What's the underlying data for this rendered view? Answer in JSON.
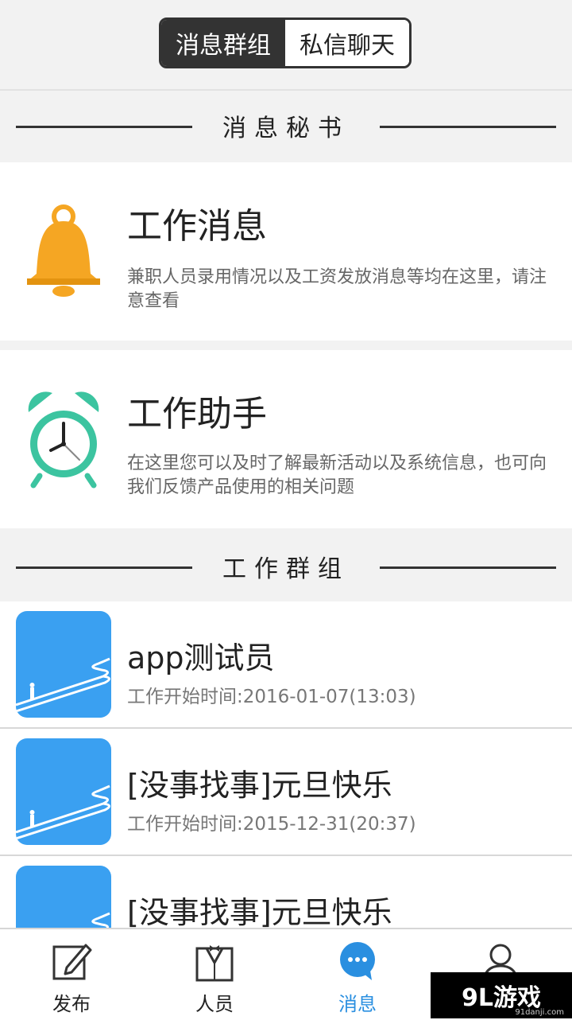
{
  "segmented": {
    "tab_groups": "消息群组",
    "tab_private": "私信聊天"
  },
  "sections": {
    "secretary": "消息秘书",
    "work_groups": "工作群组"
  },
  "secretary_items": [
    {
      "title": "工作消息",
      "desc": "兼职人员录用情况以及工资发放消息等均在这里，请注意查看"
    },
    {
      "title": "工作助手",
      "desc": "在这里您可以及时了解最新活动以及系统信息，也可向我们反馈产品使用的相关问题"
    }
  ],
  "groups": [
    {
      "title": "app测试员",
      "time": "工作开始时间:2016-01-07(13:03)"
    },
    {
      "title": "[没事找事]元旦快乐",
      "time": "工作开始时间:2015-12-31(20:37)"
    },
    {
      "title": "[没事找事]元旦快乐",
      "time": ""
    }
  ],
  "tabbar": {
    "publish": "发布",
    "people": "人员",
    "messages": "消息",
    "profile": ""
  },
  "watermark": {
    "text": "9L游戏",
    "sub": "91danji.com"
  },
  "colors": {
    "accent": "#2a8fe0",
    "group_avatar": "#3aa0f1",
    "bell": "#f5a623",
    "clock": "#3cc4a0"
  }
}
